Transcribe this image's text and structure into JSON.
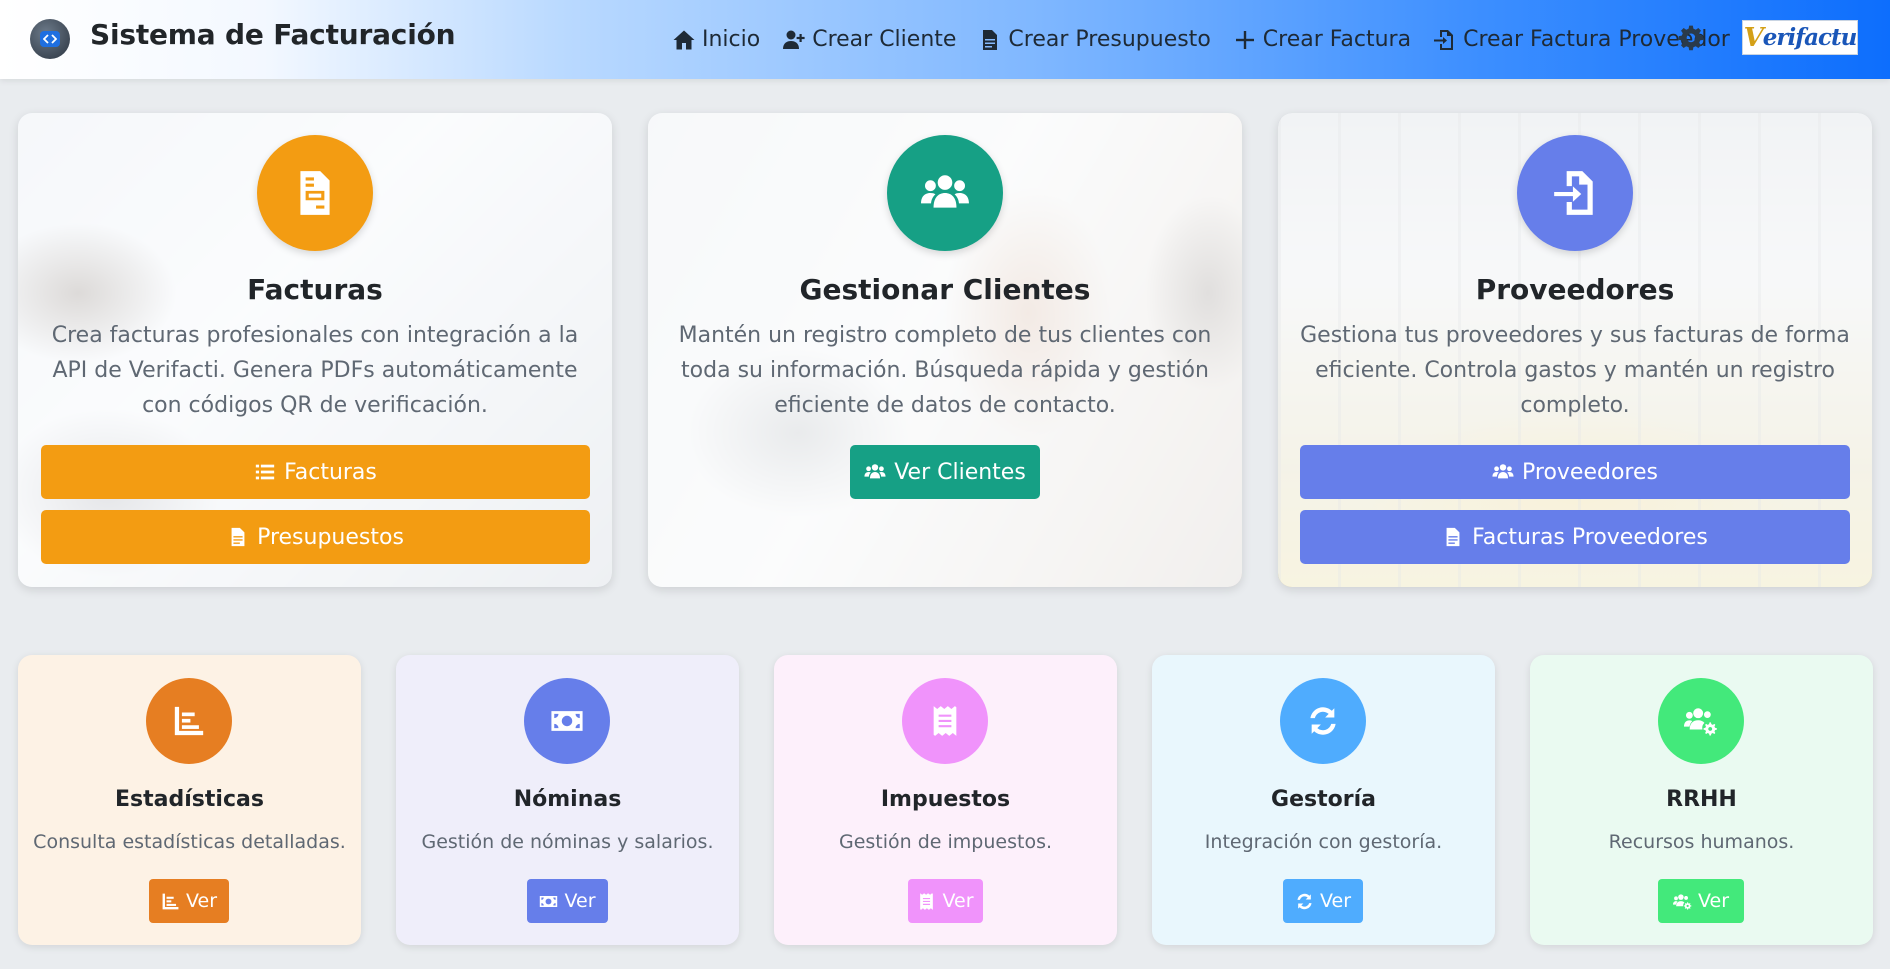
{
  "navbar": {
    "brand_title": "Sistema de Facturación",
    "links": [
      {
        "label": "Inicio",
        "icon": "home-icon"
      },
      {
        "label": "Crear Cliente",
        "icon": "user-plus-icon"
      },
      {
        "label": "Crear Presupuesto",
        "icon": "document-icon"
      },
      {
        "label": "Crear Factura",
        "icon": "plus-icon"
      },
      {
        "label": "Crear Factura Proveedor",
        "icon": "file-import-icon"
      }
    ],
    "settings_icon": "gear-icon",
    "logo_text_prefix": "V",
    "logo_text": "erifactu"
  },
  "cards": {
    "facturas": {
      "title": "Facturas",
      "description": "Crea facturas profesionales con integración a la API de Verifacti. Genera PDFs automáticamente con códigos QR de verificación.",
      "buttons": [
        "Facturas",
        "Presupuestos"
      ],
      "color": "#f39c12"
    },
    "clientes": {
      "title": "Gestionar Clientes",
      "description": "Mantén un registro completo de tus clientes con toda su información. Búsqueda rápida y gestión eficiente de datos de contacto.",
      "buttons": [
        "Ver Clientes"
      ],
      "color": "#16a085"
    },
    "proveedores": {
      "title": "Proveedores",
      "description": "Gestiona tus proveedores y sus facturas de forma eficiente. Controla gastos y mantén un registro completo.",
      "buttons": [
        "Proveedores",
        "Facturas Proveedores"
      ],
      "color": "#667eea"
    }
  },
  "small_cards": [
    {
      "title": "Estadísticas",
      "description": "Consulta estadísticas detalladas.",
      "button": "Ver",
      "color": "#e67e22",
      "bg": "#fdf2e5",
      "icon": "chart-icon"
    },
    {
      "title": "Nóminas",
      "description": "Gestión de nóminas y salarios.",
      "button": "Ver",
      "color": "#667eea",
      "bg": "#efeefa",
      "icon": "money-icon"
    },
    {
      "title": "Impuestos",
      "description": "Gestión de impuestos.",
      "button": "Ver",
      "color": "#f093fb",
      "bg": "#fdf0fb",
      "icon": "receipt-icon"
    },
    {
      "title": "Gestoría",
      "description": "Integración con gestoría.",
      "button": "Ver",
      "color": "#4facfe",
      "bg": "#e9f7fd",
      "icon": "sync-icon"
    },
    {
      "title": "RRHH",
      "description": "Recursos humanos.",
      "button": "Ver",
      "color": "#43e97b",
      "bg": "#eafaf1",
      "icon": "users-cog-icon"
    }
  ]
}
